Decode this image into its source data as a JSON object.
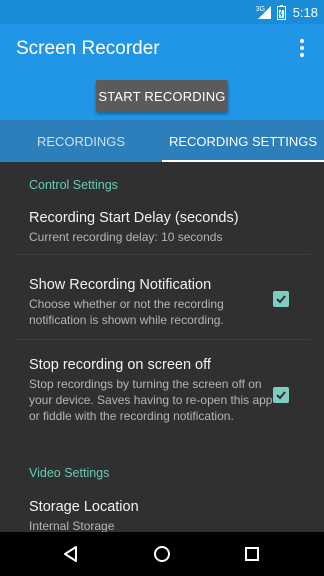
{
  "status_bar": {
    "network_label": "3G",
    "time": "5:18"
  },
  "app_bar": {
    "title": "Screen Recorder",
    "start_button_label": "START RECORDING"
  },
  "tabs": [
    {
      "label": "RECORDINGS",
      "active": false
    },
    {
      "label": "RECORDING SETTINGS",
      "active": true
    }
  ],
  "settings": {
    "control_header": "Control Settings",
    "start_delay": {
      "title": "Recording Start Delay (seconds)",
      "summary": "Current recording delay: 10 seconds"
    },
    "show_notification": {
      "title": "Show Recording Notification",
      "summary": "Choose whether or not the recording notification is shown while recording.",
      "checked": true
    },
    "stop_on_screen_off": {
      "title": "Stop recording on screen off",
      "summary": "Stop recordings by turning the screen off on your device. Saves having to re-open this app or fiddle with the recording notification.",
      "checked": true
    },
    "video_header": "Video Settings",
    "storage_location": {
      "title": "Storage Location",
      "summary": "Internal Storage"
    }
  },
  "colors": {
    "app_bar": "#2196e6",
    "status_bar": "#1a8cd8",
    "tabs": "#2d7fbb",
    "accent": "#69c9b5",
    "background": "#303030"
  }
}
